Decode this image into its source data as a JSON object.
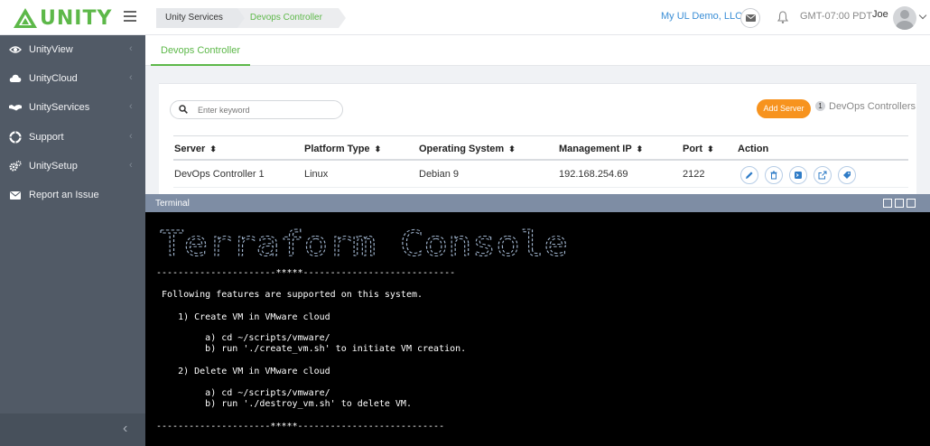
{
  "app": {
    "logo_text": "UNITY",
    "brand_color": "#5db849"
  },
  "breadcrumb": [
    "Unity Services",
    "Devops Controller"
  ],
  "header": {
    "org": "My UL Demo, LLC",
    "timezone": "GMT-07:00 PDT",
    "user": "Joe"
  },
  "sidebar": {
    "items": [
      {
        "label": "UnityView",
        "icon": "eye-icon",
        "chevron": "‹"
      },
      {
        "label": "UnityCloud",
        "icon": "cloud-icon",
        "chevron": "‹"
      },
      {
        "label": "UnityServices",
        "icon": "handshake-icon",
        "chevron": "‹"
      },
      {
        "label": "Support",
        "icon": "lifebuoy-icon",
        "chevron": "‹"
      },
      {
        "label": "UnitySetup",
        "icon": "cogs-icon",
        "chevron": "‹"
      },
      {
        "label": "Report an Issue",
        "icon": "envelope-icon",
        "chevron": ""
      }
    ],
    "collapse": "‹"
  },
  "tabs": [
    {
      "label": "Devops Controller",
      "active": true
    }
  ],
  "toolbar": {
    "search_placeholder": "Enter keyword",
    "add_button": "Add Server",
    "count": "1",
    "count_label": "DevOps Controllers",
    "accent": "#f7931e"
  },
  "table": {
    "sort_glyph": "⬍",
    "columns": [
      "Server",
      "Platform Type",
      "Operating System",
      "Management IP",
      "Port",
      "Action"
    ],
    "rows": [
      {
        "server": "DevOps Controller 1",
        "platform": "Linux",
        "os": "Debian 9",
        "ip": "192.168.254.69",
        "port": "2122",
        "actions": [
          "edit-icon",
          "delete-icon",
          "console-icon",
          "open-external-icon",
          "tag-icon"
        ]
      }
    ]
  },
  "terminal": {
    "title": "Terminal",
    "banner_text": "Terraform Console",
    "lines": [
      "----------------------*****----------------------------",
      " Following features are supported on this system.",
      "    1) Create VM in VMware cloud",
      "         a) cd ~/scripts/vmware/",
      "         b) run './create_vm.sh' to initiate VM creation.",
      "    2) Delete VM in VMware cloud",
      "         a) cd ~/scripts/vmware/",
      "         b) run './destroy_vm.sh' to delete VM.",
      "---------------------*****---------------------------"
    ]
  }
}
